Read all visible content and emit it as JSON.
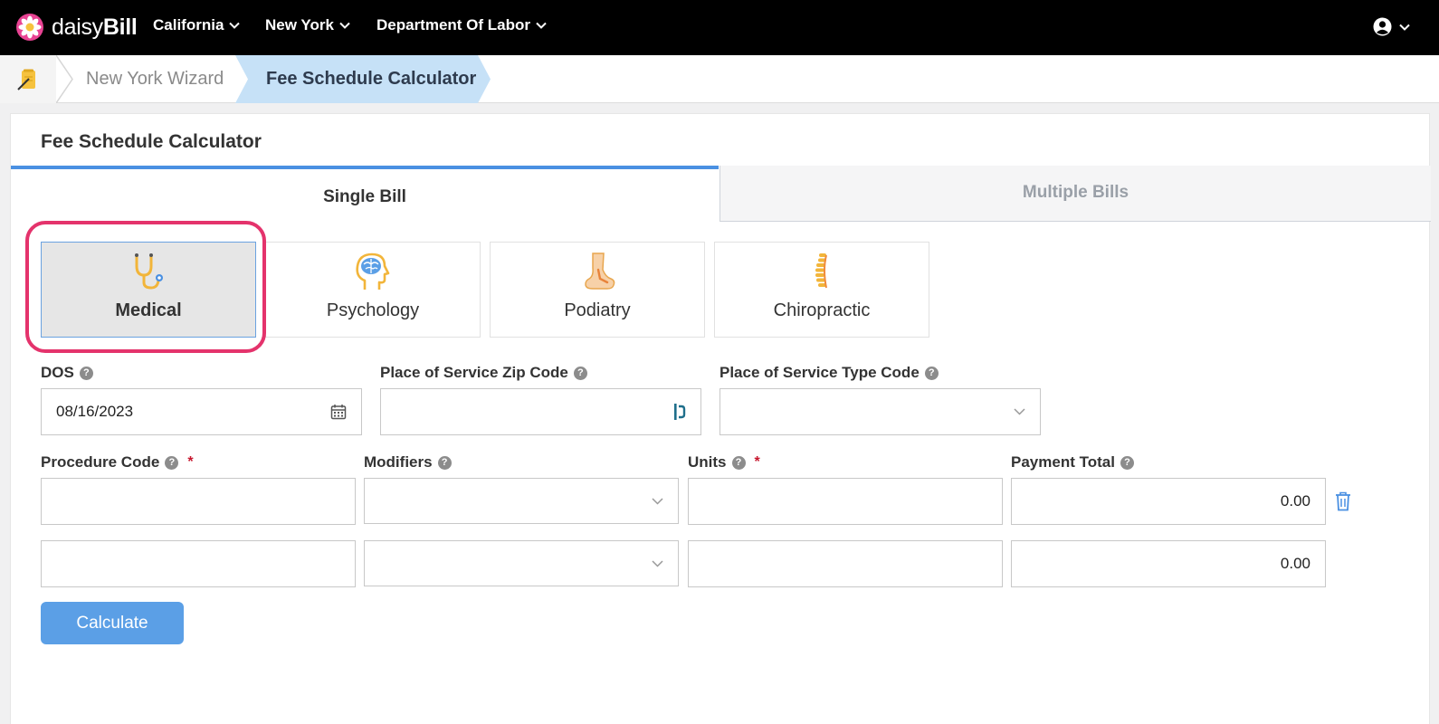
{
  "brand": {
    "light": "daisy",
    "bold": "Bill"
  },
  "nav": {
    "items": [
      "California",
      "New York",
      "Department Of Labor"
    ]
  },
  "breadcrumb": {
    "link": "New York Wizard",
    "active": "Fee Schedule Calculator"
  },
  "card": {
    "title": "Fee Schedule Calculator"
  },
  "tabs": {
    "single": "Single Bill",
    "multiple": "Multiple Bills"
  },
  "bill_types": [
    "Medical",
    "Psychology",
    "Podiatry",
    "Chiropractic"
  ],
  "fields": {
    "dos": {
      "label": "DOS",
      "value": "08/16/2023"
    },
    "zip": {
      "label": "Place of Service Zip Code",
      "value": ""
    },
    "pos_type": {
      "label": "Place of Service Type Code",
      "value": ""
    },
    "procedure": {
      "label": "Procedure Code",
      "required_mark": "*"
    },
    "modifiers": {
      "label": "Modifiers"
    },
    "units": {
      "label": "Units",
      "required_mark": "*"
    },
    "payment_total": {
      "label": "Payment Total"
    }
  },
  "rows": [
    {
      "payment_total": "0.00"
    },
    {
      "payment_total": "0.00"
    }
  ],
  "buttons": {
    "calculate": "Calculate"
  },
  "colors": {
    "accent": "#4a90e2",
    "button": "#5b9fe6",
    "highlight": "#e4336c",
    "brand_pink": "#e84393"
  }
}
